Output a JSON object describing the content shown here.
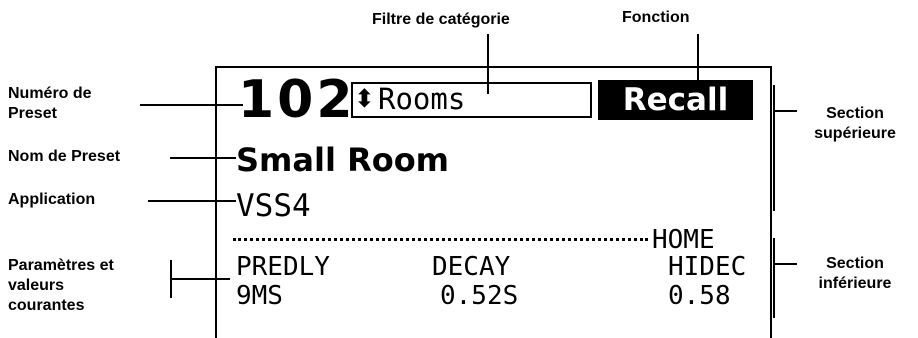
{
  "annotations": {
    "category_filter": "Filtre de catégorie",
    "function": "Fonction",
    "preset_number_line1": "Numéro de",
    "preset_number_line2": "Preset",
    "preset_name": "Nom de Preset",
    "application": "Application",
    "params_line1": "Paramètres et",
    "params_line2": "valeurs",
    "params_line3": "courantes",
    "upper_section_line1": "Section",
    "upper_section_line2": "supérieure",
    "lower_section_line1": "Section",
    "lower_section_line2": "inférieure"
  },
  "display": {
    "preset_number": "102",
    "category_arrows": "⬍",
    "category": "Rooms",
    "function": "Recall",
    "preset_name": "Small Room",
    "application": "VSS4",
    "home": "HOME",
    "params": [
      {
        "name": "PREDLY",
        "value": "9MS"
      },
      {
        "name": "DECAY",
        "value": "0.52S"
      },
      {
        "name": "HIDEC",
        "value": "0.58"
      }
    ]
  }
}
